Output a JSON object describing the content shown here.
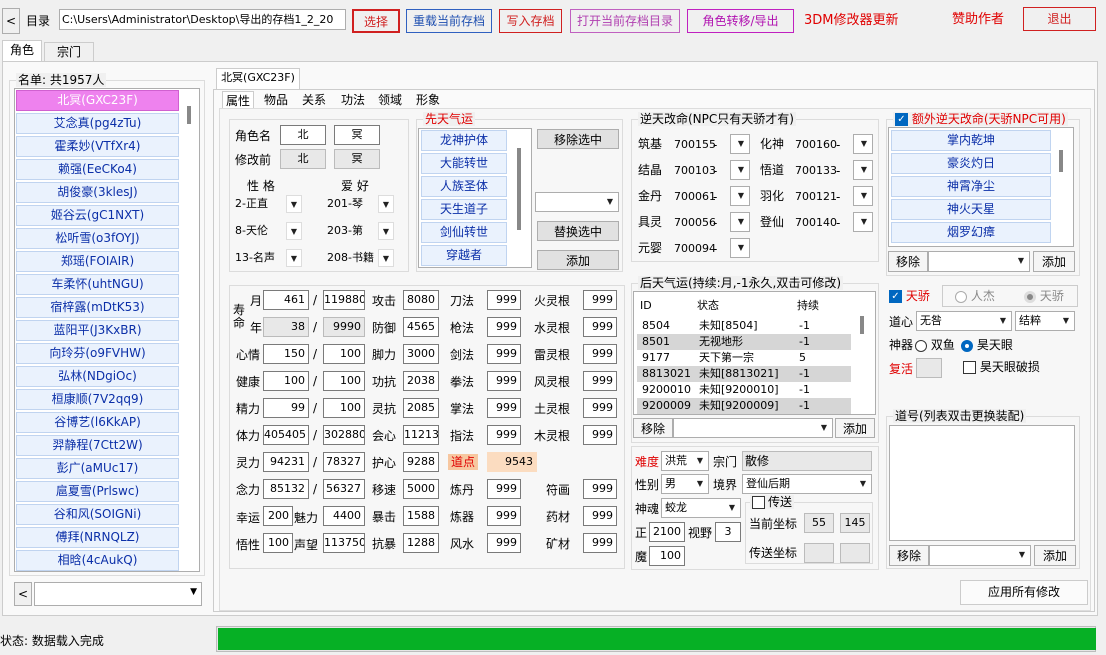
{
  "toolbar": {
    "back": "<",
    "dir_label": "目录",
    "path": "C:\\Users\\Administrator\\Desktop\\导出的存档1_2_20",
    "select": "选择",
    "reload": "重载当前存档",
    "write": "写入存档",
    "open_dir": "打开当前存档目录",
    "transfer": "角色转移/导出",
    "update": "3DM修改器更新",
    "sponsor": "赞助作者",
    "exit": "退出"
  },
  "main_tabs": [
    "角色",
    "宗门"
  ],
  "list": {
    "header": "名单: 共1957人",
    "items": [
      "北冥(GXC23F)",
      "艾念真(pg4zTu)",
      "霍柔妙(VTfXr4)",
      "赖强(EeCKo4)",
      "胡俊豪(3klesJ)",
      "姬谷云(gC1NXT)",
      "松听雪(o3fOYJ)",
      "郑瑶(FOIAIR)",
      "车柔怀(uhtNGU)",
      "宿梓露(mDtK53)",
      "蓝阳平(J3KxBR)",
      "向玲芬(o9FVHW)",
      "弘林(NDgiOc)",
      "桓康顺(7V2qq9)",
      "谷博艺(l6KkAP)",
      "羿静程(7Ctt2W)",
      "彭广(aMUc17)",
      "扈夏雪(Prlswc)",
      "谷和风(SOIGNi)",
      "傅拜(NRNQLZ)",
      "相晗(4cAukQ)"
    ],
    "nav_left": "<"
  },
  "char_tab": "北冥(GXC23F)",
  "sub_tabs": [
    "属性",
    "物品",
    "关系",
    "功法",
    "领域",
    "形象"
  ],
  "name": {
    "label": "角色名",
    "first": "北",
    "last": "冥",
    "prev_label": "修改前",
    "prev_first": "北",
    "prev_last": "冥"
  },
  "traits": {
    "xingge_label": "性 格",
    "aihao_label": "爱 好",
    "xingge": [
      "2-正直",
      "8-天伦",
      "13-名声"
    ],
    "aihao": [
      "201-琴",
      "203-第",
      "208-书籍"
    ]
  },
  "xiantian": {
    "title": "先天气运",
    "items": [
      "龙神护体",
      "大能转世",
      "人族圣体",
      "天生道子",
      "剑仙转世",
      "穿越者"
    ],
    "remove": "移除选中",
    "replace": "替换选中",
    "add": "添加"
  },
  "nitian": {
    "title": "逆天改命(NPC只有天骄才有)",
    "rows": [
      {
        "l1": "筑基",
        "v1": "700155",
        "l2": "化神",
        "v2": "700160"
      },
      {
        "l1": "结晶",
        "v1": "700103",
        "l2": "悟道",
        "v2": "700133"
      },
      {
        "l1": "金丹",
        "v1": "700061",
        "l2": "羽化",
        "v2": "700121"
      },
      {
        "l1": "具灵",
        "v1": "700056",
        "l2": "登仙",
        "v2": "700140"
      },
      {
        "l1": "元婴",
        "v1": "700094",
        "l2": "",
        "v2": ""
      }
    ],
    "dash": "-"
  },
  "extra": {
    "title": "额外逆天改命(天骄NPC可用)",
    "items": [
      "掌内乾坤",
      "豪炎灼日",
      "神霄净尘",
      "神火天星",
      "烟罗幻瘴"
    ],
    "remove": "移除",
    "add": "添加"
  },
  "houtian": {
    "title": "后天气运(持续:月,-1永久,双击可修改)",
    "headers": [
      "ID",
      "状态",
      "持续"
    ],
    "rows": [
      [
        "8504",
        "未知[8504]",
        "-1"
      ],
      [
        "8501",
        "无视地形",
        "-1"
      ],
      [
        "9177",
        "天下第一宗",
        "5"
      ],
      [
        "8813021",
        "未知[8813021]",
        "-1"
      ],
      [
        "9200010",
        "未知[9200010]",
        "-1"
      ],
      [
        "9200009",
        "未知[9200009]",
        "-1"
      ]
    ],
    "remove": "移除",
    "add": "添加"
  },
  "tianjiao": {
    "label": "天骄",
    "renjie": "人杰",
    "tianjiao2": "天骄",
    "xinxin_label": "道心",
    "xinxin": "无咎",
    "jiexin": "结粹",
    "shenqi_label": "神器",
    "shuangyu": "双鱼",
    "haotian": "昊天眼",
    "fuhuo_label": "复活",
    "haotian_broken": "昊天眼破损"
  },
  "daohao": {
    "title": "道号(列表双击更换装配)",
    "remove": "移除",
    "add": "添加"
  },
  "stats": {
    "shouming": "寿命",
    "yue": "月",
    "nian": "年",
    "yue_v": "461",
    "yue_max": "119880",
    "nian_v": "38",
    "nian_max": "9990",
    "rows": [
      {
        "l": "心情",
        "v": "150",
        "m": "100"
      },
      {
        "l": "健康",
        "v": "100",
        "m": "100"
      },
      {
        "l": "精力",
        "v": "99",
        "m": "100"
      },
      {
        "l": "体力",
        "v": "405405",
        "m": "302880"
      },
      {
        "l": "灵力",
        "v": "94231",
        "m": "78327"
      },
      {
        "l": "念力",
        "v": "85132",
        "m": "56327"
      }
    ],
    "xingyun_l": "幸运",
    "xingyun": "200",
    "meili_l": "魅力",
    "meili": "4400",
    "wuxing_l": "悟性",
    "wuxing": "100",
    "shengwang_l": "声望",
    "shengwang": "113750",
    "col2": [
      {
        "l": "攻击",
        "v": "8080"
      },
      {
        "l": "防御",
        "v": "4565"
      },
      {
        "l": "脚力",
        "v": "3000"
      },
      {
        "l": "功抗",
        "v": "2038"
      },
      {
        "l": "灵抗",
        "v": "2085"
      },
      {
        "l": "会心",
        "v": "11213"
      },
      {
        "l": "护心",
        "v": "9288"
      },
      {
        "l": "移速",
        "v": "5000"
      },
      {
        "l": "暴击",
        "v": "1588"
      },
      {
        "l": "抗暴",
        "v": "1288"
      }
    ],
    "col3": [
      {
        "l": "刀法",
        "v": "999"
      },
      {
        "l": "枪法",
        "v": "999"
      },
      {
        "l": "剑法",
        "v": "999"
      },
      {
        "l": "拳法",
        "v": "999"
      },
      {
        "l": "掌法",
        "v": "999"
      },
      {
        "l": "指法",
        "v": "999"
      },
      {
        "l": "道点",
        "v": "9543"
      },
      {
        "l": "炼丹",
        "v": "999"
      },
      {
        "l": "炼器",
        "v": "999"
      },
      {
        "l": "风水",
        "v": "999"
      }
    ],
    "col4": [
      {
        "l": "火灵根",
        "v": "999"
      },
      {
        "l": "水灵根",
        "v": "999"
      },
      {
        "l": "雷灵根",
        "v": "999"
      },
      {
        "l": "风灵根",
        "v": "999"
      },
      {
        "l": "土灵根",
        "v": "999"
      },
      {
        "l": "木灵根",
        "v": "999"
      },
      {
        "l": "符画",
        "v": "999"
      },
      {
        "l": "药材",
        "v": "999"
      },
      {
        "l": "矿材",
        "v": "999"
      }
    ]
  },
  "misc": {
    "nandu_l": "难度",
    "nandu": "洪荒",
    "zongmen_l": "宗门",
    "zongmen": "散修",
    "xingbie_l": "性别",
    "xingbie": "男",
    "jingjie_l": "境界",
    "jingjie": "登仙后期",
    "shenhun_l": "神魂",
    "shenhun": "蛟龙",
    "chuansong": "传送",
    "zheng_l": "正",
    "zheng": "2100",
    "shiye_l": "视野",
    "shiye": "3",
    "mo_l": "魔",
    "mo": "100",
    "cur_l": "当前坐标",
    "cur_x": "55",
    "cur_y": "145",
    "tp_l": "传送坐标"
  },
  "apply": "应用所有修改",
  "status": "状态: 数据载入完成",
  "progress": 1.0
}
